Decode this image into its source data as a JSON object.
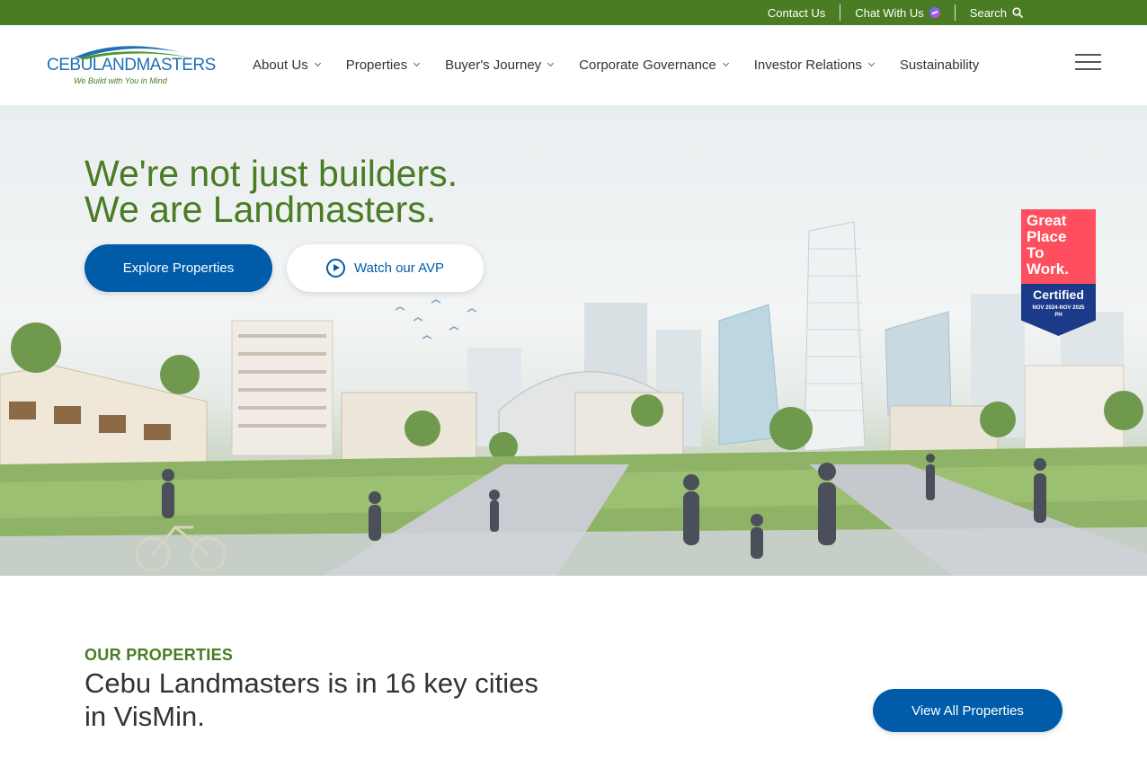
{
  "topbar": {
    "contact_label": "Contact Us",
    "chat_label": "Chat With Us",
    "search_label": "Search",
    "background_color": "#4a7c23"
  },
  "logo": {
    "name_part1": "CEBU",
    "name_part2": "LANDMASTERS",
    "tagline": "We Build with You in Mind"
  },
  "nav": {
    "items": [
      {
        "label": "About Us",
        "has_dropdown": true
      },
      {
        "label": "Properties",
        "has_dropdown": true
      },
      {
        "label": "Buyer's Journey",
        "has_dropdown": true
      },
      {
        "label": "Corporate Governance",
        "has_dropdown": true
      },
      {
        "label": "Investor Relations",
        "has_dropdown": true
      },
      {
        "label": "Sustainability",
        "has_dropdown": false
      }
    ],
    "menu_icon": "hamburger-icon"
  },
  "hero": {
    "headline_line1": "We're not just builders.",
    "headline_line2": "We are Landmasters.",
    "primary_button": "Explore Properties",
    "secondary_button": "Watch our AVP",
    "secondary_icon": "play-circle-icon",
    "accent_color": "#4a7c23",
    "button_color": "#005ca9"
  },
  "badge": {
    "line1": "Great",
    "line2": "Place",
    "line3": "To",
    "line4": "Work.",
    "certified": "Certified",
    "dates": "NOV 2024-NOV 2025",
    "country": "PH"
  },
  "properties": {
    "eyebrow": "OUR PROPERTIES",
    "title": "Cebu Landmasters is in 16 key cities in VisMin.",
    "button": "View All Properties"
  }
}
